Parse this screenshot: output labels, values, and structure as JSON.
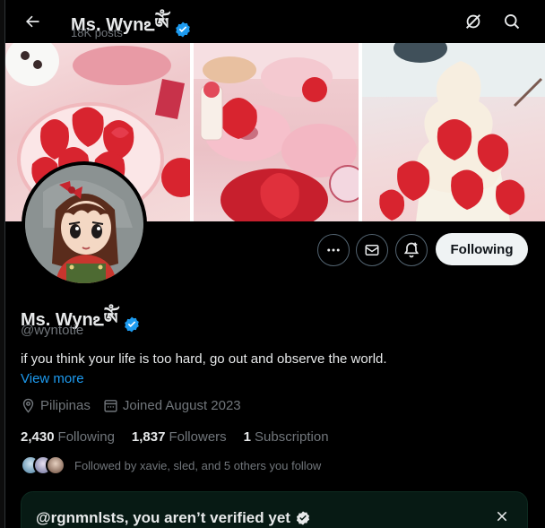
{
  "header": {
    "name": "Ms. Wynఽༀ",
    "posts": "18K posts"
  },
  "profile": {
    "name": "Ms. Wynఽༀ",
    "handle": "@wyntotie",
    "bio": "if you think your life is too hard, go out and observe the world.",
    "view_more": "View more",
    "location": "Pilipinas",
    "joined": "Joined August 2023"
  },
  "stats": {
    "following_count": "2,430",
    "following_label": "Following",
    "followers_count": "1,837",
    "followers_label": "Followers",
    "subscription_count": "1",
    "subscription_label": "Subscription"
  },
  "followed_by": "Followed by xavie, sled, and 5 others you follow",
  "actions": {
    "following_button": "Following"
  },
  "verify_card": {
    "title": "@rgnmnlsts, you aren’t verified yet"
  },
  "colors": {
    "accent": "#1d9bf0",
    "background": "#000000",
    "verified_badge": "#1d9bf0"
  },
  "icons": [
    "back-arrow-icon",
    "verified-badge-icon",
    "grok-icon",
    "search-icon",
    "more-icon",
    "message-icon",
    "notification-bell-icon",
    "location-icon",
    "calendar-icon",
    "close-icon"
  ]
}
